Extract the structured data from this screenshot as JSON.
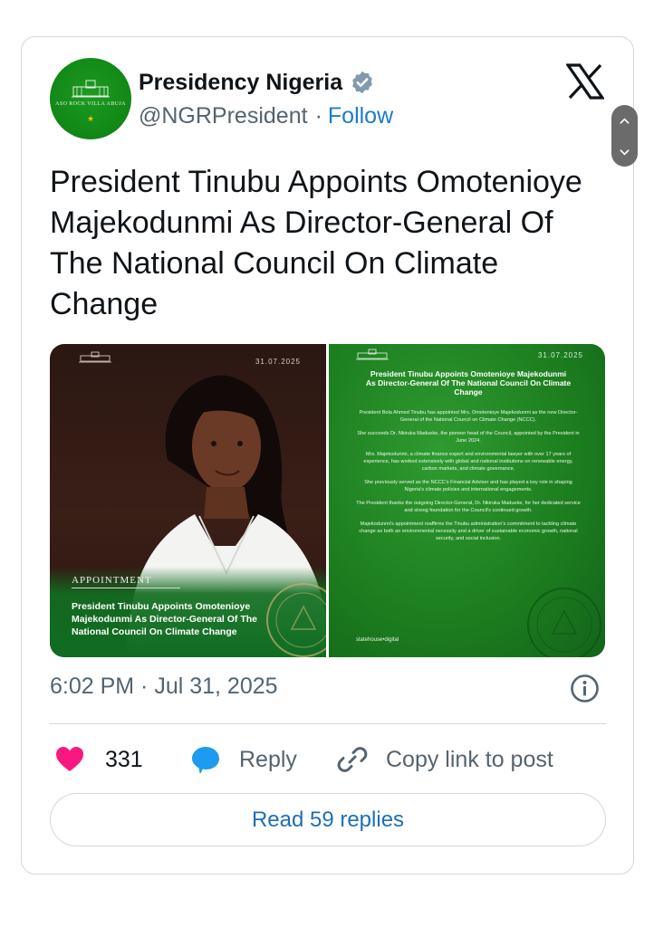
{
  "account": {
    "name": "Presidency Nigeria",
    "handle": "@NGRPresident",
    "separator": "·",
    "follow_label": "Follow",
    "avatar_text": "ASO ROCK VILLA ABUJA"
  },
  "icons": {
    "verified": "verified-badge-icon",
    "brand": "x-logo-icon",
    "scroll_up": "chevron-up-icon",
    "scroll_down": "chevron-down-icon",
    "info": "info-icon",
    "like": "heart-icon",
    "reply": "speech-bubble-icon",
    "copy": "link-icon"
  },
  "tweet": {
    "text": "President Tinubu Appoints Omotenioye Majekodunmi As Director-General Of The National Council On Climate Change",
    "timestamp": "6:02 PM · Jul 31, 2025"
  },
  "media": {
    "left": {
      "date": "31.07.2025",
      "label": "APPOINTMENT",
      "title": "President Tinubu Appoints Omotenioye Majekodunmi As Director-General Of The National Council On Climate Change"
    },
    "right": {
      "date": "31.07.2025",
      "headline": "President Tinubu Appoints Omotenioye Majekodunmi As Director-General Of The National Council On Climate Change",
      "paragraphs": [
        "President Bola Ahmed Tinubu has appointed Mrs. Omotenioye Majekodunmi as the new Director-General of the National Council on Climate Change (NCCC).",
        "She succeeds Dr. Nkiruka Madueke, the pioneer head of the Council, appointed by the President in June 2024.",
        "Mrs. Majekodunmi, a climate finance expert and environmental lawyer with over 17 years of experience, has worked extensively with global and national institutions on renewable energy, carbon markets, and climate governance.",
        "She previously served as the NCCC's Financial Adviser and has played a key role in shaping Nigeria's climate policies and international engagements.",
        "The President thanks the outgoing Director-General, Dr. Nkiruka Madueke, for her dedicated service and strong foundation for the Council's continued growth.",
        "Majekodunmi's appointment reaffirms the Tinubu administration's commitment to tackling climate change as both an environmental necessity and a driver of sustainable economic growth, national security, and social inclusion."
      ],
      "footer": "statehouse•digital"
    }
  },
  "actions": {
    "like_count": "331",
    "reply_label": "Reply",
    "copy_label": "Copy link to post",
    "read_replies_label": "Read 59 replies"
  },
  "colors": {
    "link_blue": "#1d7bc9",
    "like_pink": "#f91880",
    "reply_blue": "#1d9bf0",
    "brand_green": "#138a17"
  }
}
